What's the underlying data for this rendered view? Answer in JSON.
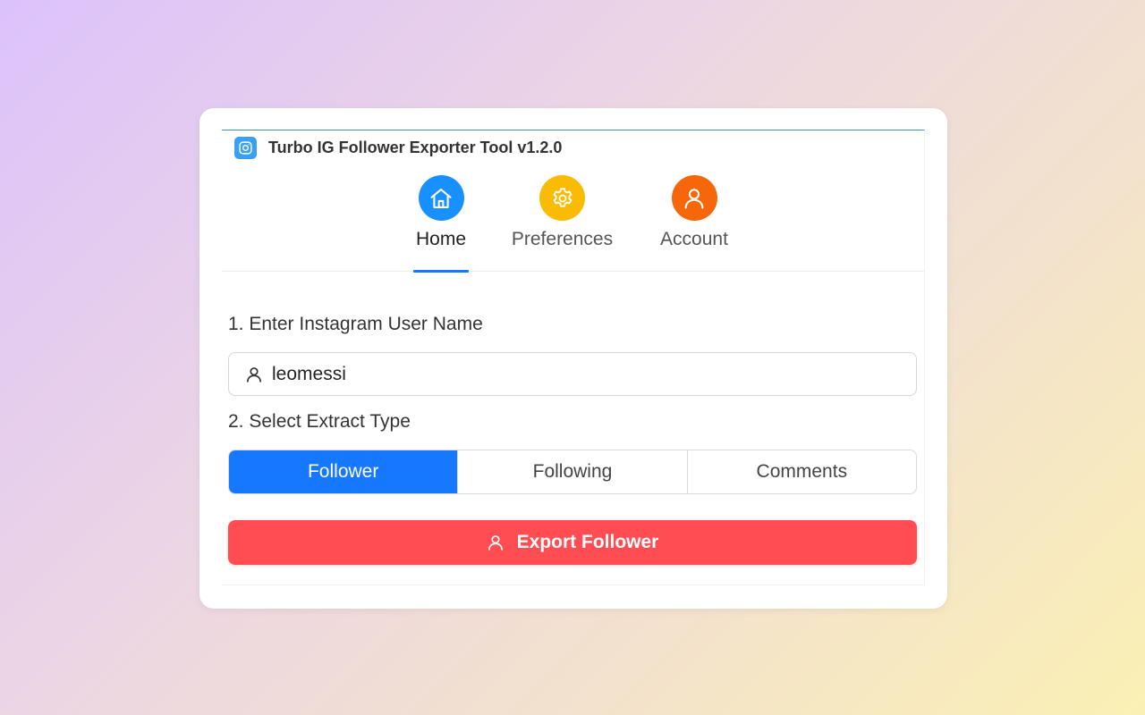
{
  "app": {
    "title": "Turbo IG Follower Exporter Tool v1.2.0",
    "icon": "instagram-icon"
  },
  "tabs": [
    {
      "label": "Home",
      "icon": "home-icon",
      "color": "#1890ff",
      "active": true
    },
    {
      "label": "Preferences",
      "icon": "gear-icon",
      "color": "#fabb05",
      "active": false
    },
    {
      "label": "Account",
      "icon": "user-icon",
      "color": "#f5670a",
      "active": false
    }
  ],
  "form": {
    "username_label": "1. Enter Instagram User Name",
    "username_value": "leomessi",
    "extract_label": "2. Select Extract Type",
    "extract_options": [
      "Follower",
      "Following",
      "Comments"
    ],
    "selected_option": "Follower",
    "export_button": "Export Follower"
  },
  "colors": {
    "accent": "#1677ff",
    "export": "#ff4d53"
  }
}
